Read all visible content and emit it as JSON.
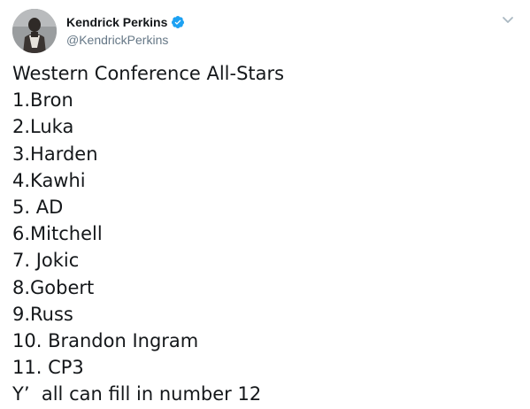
{
  "tweet": {
    "author": {
      "display_name": "Kendrick Perkins",
      "handle": "@KendrickPerkins",
      "verified": true
    },
    "lines": [
      "Western Conference All-Stars",
      "1.Bron",
      "2.Luka",
      "3.Harden",
      "4.Kawhi",
      "5. AD",
      "6.Mitchell",
      "7. Jokic",
      "8.Gobert",
      "9.Russ",
      "10. Brandon Ingram",
      "11. CP3",
      "Y’  all can fill in number 12"
    ]
  },
  "icons": {
    "verified": "verified-badge-icon",
    "menu": "chevron-down-icon"
  },
  "colors": {
    "text_primary": "#14171a",
    "text_secondary": "#657786",
    "verified_blue": "#1da1f2",
    "chevron": "#aab8c2",
    "background": "#ffffff"
  }
}
